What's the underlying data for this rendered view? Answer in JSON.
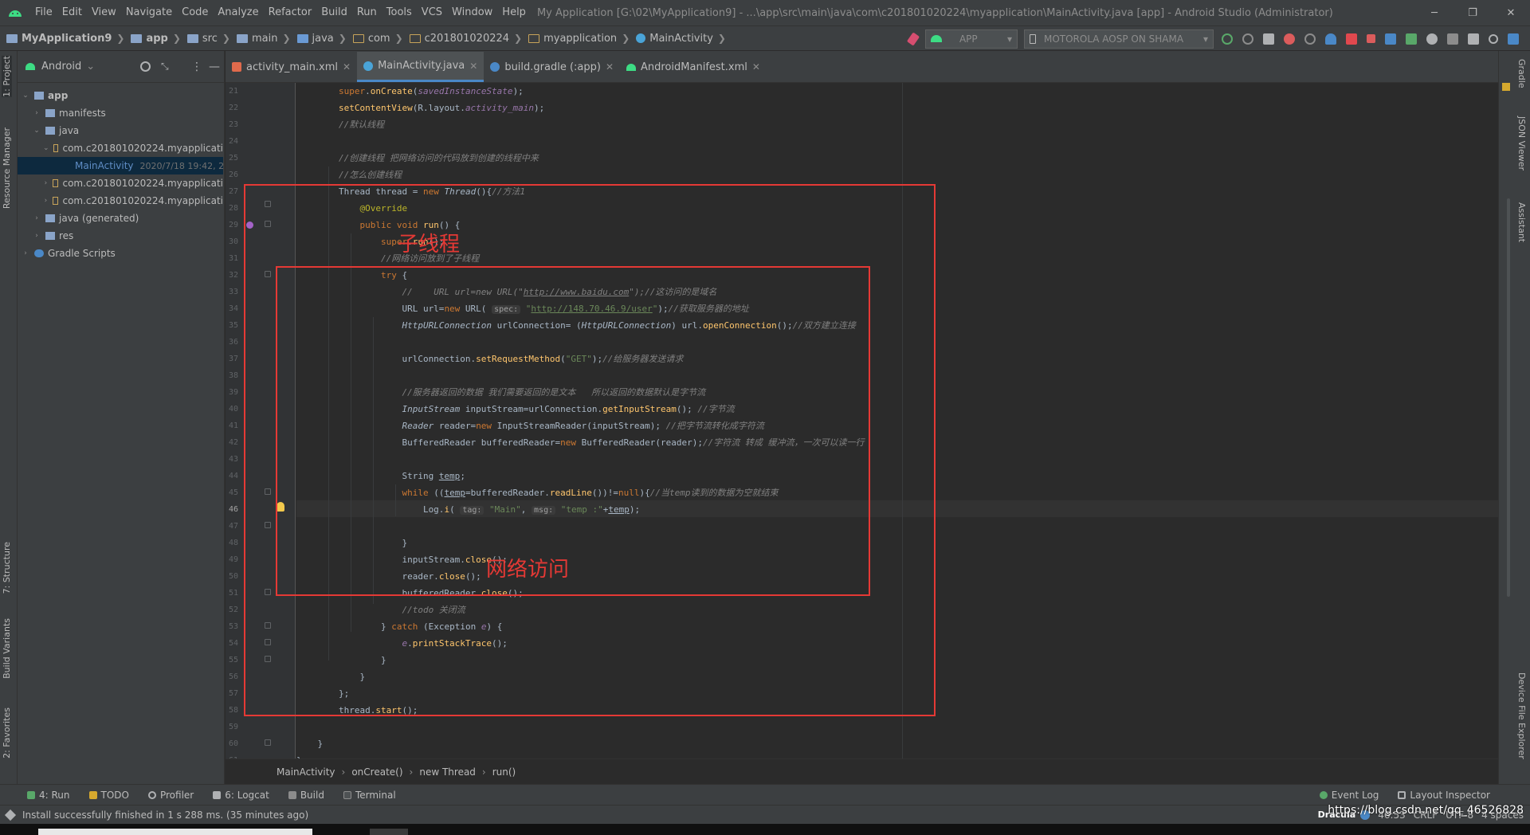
{
  "menubar": {
    "items": [
      "File",
      "Edit",
      "View",
      "Navigate",
      "Code",
      "Analyze",
      "Refactor",
      "Build",
      "Run",
      "Tools",
      "VCS",
      "Window",
      "Help"
    ],
    "window_title": "My Application [G:\\02\\MyApplication9] - ...\\app\\src\\main\\java\\com\\c201801020224\\myapplication\\MainActivity.java [app] - Android Studio (Administrator)",
    "minimize": "─",
    "maximize": "❐",
    "close": "✕"
  },
  "navbar": {
    "crumbs": [
      "MyApplication9",
      "app",
      "src",
      "main",
      "java",
      "com",
      "c201801020224",
      "myapplication",
      "MainActivity"
    ],
    "run_config": "APP",
    "device": "MOTOROLA AOSP ON SHAMA"
  },
  "left_strip": {
    "project_tab": "1: Project",
    "resource_manager": "Resource Manager",
    "structure_tab": "7: Structure",
    "build_variants": "Build Variants",
    "favorites_tab": "2: Favorites"
  },
  "project_panel": {
    "view_selector": "Android",
    "tree": [
      {
        "label": "app",
        "depth": 0,
        "icon": "module-folder-icon"
      },
      {
        "label": "manifests",
        "depth": 1,
        "icon": "folder-icon"
      },
      {
        "label": "java",
        "depth": 1,
        "icon": "folder-icon"
      },
      {
        "label": "com.c201801020224.myapplicati",
        "depth": 2,
        "icon": "package-icon"
      },
      {
        "label": "MainActivity",
        "depth": 3,
        "icon": "java-class-icon",
        "meta": "2020/7/18 19:42, 2"
      },
      {
        "label": "com.c201801020224.myapplicati",
        "depth": 2,
        "icon": "package-icon"
      },
      {
        "label": "com.c201801020224.myapplicati",
        "depth": 2,
        "icon": "package-icon"
      },
      {
        "label": "java (generated)",
        "depth": 1,
        "icon": "folder-icon"
      },
      {
        "label": "res",
        "depth": 1,
        "icon": "folder-icon"
      },
      {
        "label": "Gradle Scripts",
        "depth": 0,
        "icon": "gradle-icon"
      }
    ]
  },
  "tabs": [
    {
      "label": "activity_main.xml",
      "active": false
    },
    {
      "label": "MainActivity.java",
      "active": true
    },
    {
      "label": "build.gradle (:app)",
      "active": false
    },
    {
      "label": "AndroidManifest.xml",
      "active": false
    }
  ],
  "editor": {
    "line_numbers": [
      "21",
      "22",
      "23",
      "24",
      "25",
      "26",
      "27",
      "28",
      "29",
      "30",
      "31",
      "32",
      "33",
      "34",
      "35",
      "36",
      "37",
      "38",
      "39",
      "40",
      "41",
      "42",
      "43",
      "44",
      "45",
      "46",
      "47",
      "48",
      "49",
      "50",
      "51",
      "52",
      "53",
      "54",
      "55",
      "56",
      "57",
      "58",
      "59",
      "60",
      "61"
    ],
    "current_line": "46",
    "annotation_thread": "子线程",
    "annotation_network": "网络访问"
  },
  "editor_breadcrumb": [
    "MainActivity",
    "onCreate()",
    "new Thread",
    "run()"
  ],
  "right_strip": {
    "gradle": "Gradle",
    "json_viewer": "JSON Viewer",
    "assistant": "Assistant",
    "device_file_explorer": "Device File Explorer"
  },
  "bottom_tools": {
    "run": "4: Run",
    "todo": "TODO",
    "profiler": "Profiler",
    "logcat": "6: Logcat",
    "build": "Build",
    "terminal": "Terminal",
    "event_log": "Event Log",
    "layout_inspector": "Layout Inspector"
  },
  "statusbar": {
    "message": "Install successfully finished in 1 s 288 ms. (35 minutes ago)",
    "theme": "Dracula",
    "position": "46:53",
    "line_sep": "CRLF",
    "encoding": "UTF-8",
    "indent": "4 spaces",
    "watermark": "https://blog.csdn.net/qq_46526828"
  },
  "colors": {
    "accent": "#4a88c7",
    "annotation_red": "#e53935",
    "keyword": "#cc7832",
    "method": "#ffc66d",
    "string": "#6a8759",
    "comment": "#808080"
  }
}
